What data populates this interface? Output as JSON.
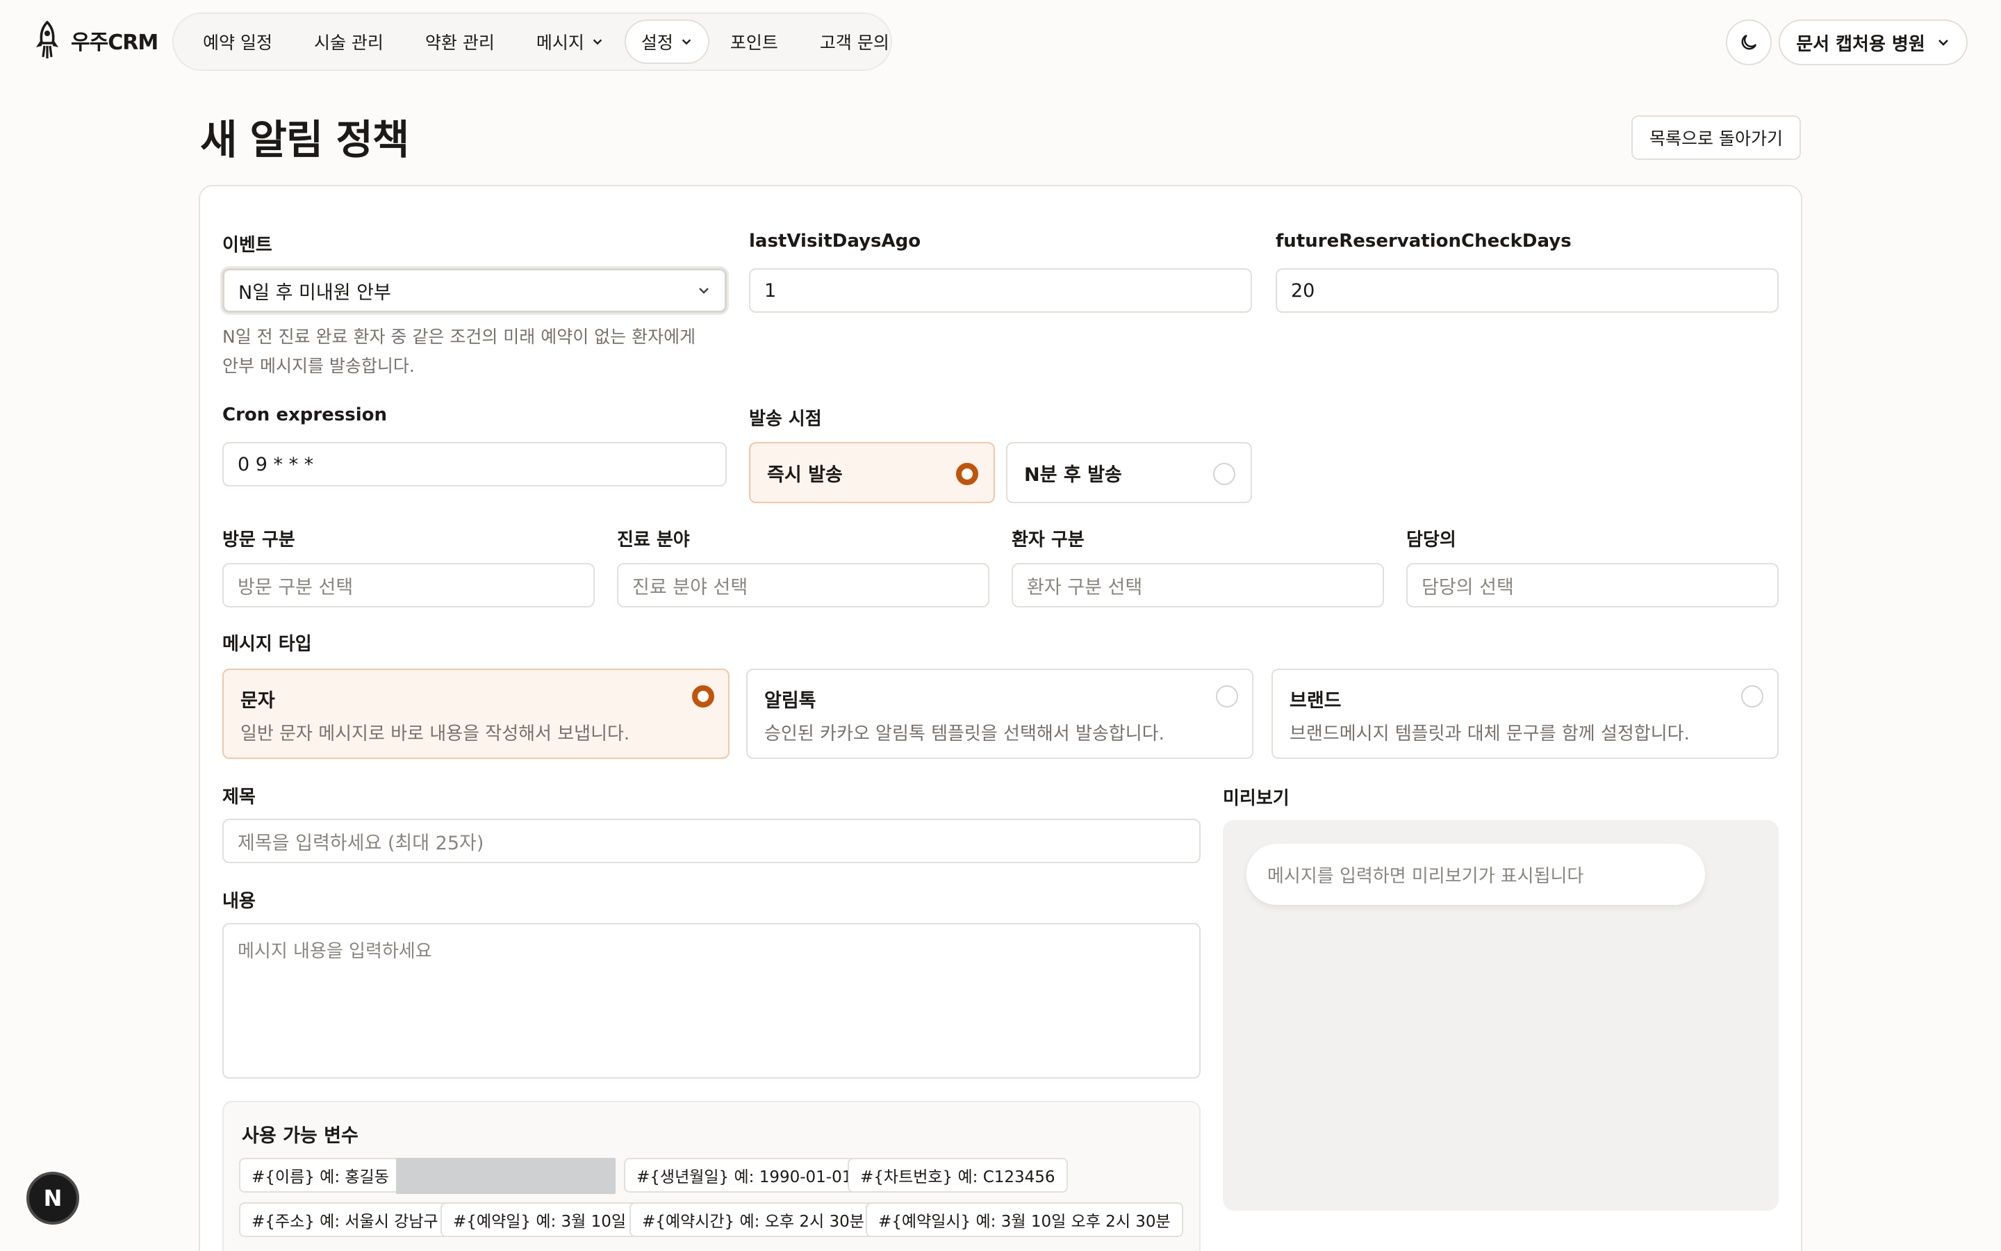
{
  "brand": {
    "name": "우주CRM"
  },
  "nav": {
    "items": [
      {
        "label": "예약 일정",
        "dropdown": false,
        "active": false
      },
      {
        "label": "시술 관리",
        "dropdown": false,
        "active": false
      },
      {
        "label": "약환 관리",
        "dropdown": false,
        "active": false
      },
      {
        "label": "메시지",
        "dropdown": true,
        "active": false
      },
      {
        "label": "설정",
        "dropdown": true,
        "active": true
      },
      {
        "label": "포인트",
        "dropdown": false,
        "active": false
      },
      {
        "label": "고객 문의",
        "dropdown": false,
        "active": false
      }
    ]
  },
  "header": {
    "hospital": "문서 캡처용 병원"
  },
  "page": {
    "title": "새 알림 정책",
    "back_button": "목록으로 돌아가기"
  },
  "form": {
    "event": {
      "label": "이벤트",
      "value": "N일 후 미내원 안부",
      "help_line1": "N일 전 진료 완료 환자 중 같은 조건의 미래 예약이 없는 환자에게",
      "help_line2": "안부 메시지를 발송합니다."
    },
    "last_visit": {
      "label": "lastVisitDaysAgo",
      "value": "1"
    },
    "future_check": {
      "label": "futureReservationCheckDays",
      "value": "20"
    },
    "cron": {
      "label": "Cron expression",
      "value": "0 9 * * *"
    },
    "send_time": {
      "label": "발송 시점",
      "options": [
        {
          "label": "즉시 발송",
          "selected": true
        },
        {
          "label": "N분 후 발송",
          "selected": false
        }
      ]
    },
    "visit_type": {
      "label": "방문 구분",
      "placeholder": "방문 구분 선택"
    },
    "department": {
      "label": "진료 분야",
      "placeholder": "진료 분야 선택"
    },
    "patient_type": {
      "label": "환자 구분",
      "placeholder": "환자 구분 선택"
    },
    "doctor": {
      "label": "담당의",
      "placeholder": "담당의 선택"
    },
    "message_type": {
      "label": "메시지 타입",
      "options": [
        {
          "title": "문자",
          "desc": "일반 문자 메시지로 바로 내용을 작성해서 보냅니다.",
          "selected": true
        },
        {
          "title": "알림톡",
          "desc": "승인된 카카오 알림톡 템플릿을 선택해서 발송합니다.",
          "selected": false
        },
        {
          "title": "브랜드",
          "desc": "브랜드메시지 템플릿과 대체 문구를 함께 설정합니다.",
          "selected": false
        }
      ]
    },
    "subject": {
      "label": "제목",
      "placeholder": "제목을 입력하세요 (최대 25자)"
    },
    "content": {
      "label": "내용",
      "placeholder": "메시지 내용을 입력하세요"
    },
    "preview": {
      "label": "미리보기",
      "empty_text": "메시지를 입력하면 미리보기가 표시됩니다"
    },
    "variables": {
      "title": "사용 가능 변수",
      "chips": [
        "#{이름} 예: 홍길동",
        "#{생년월일} 예: 1990-01-01",
        "#{차트번호} 예: C123456",
        "#{주소} 예: 서울시 강남구",
        "#{예약일} 예: 3월 10일",
        "#{예약시간} 예: 오후 2시 30분",
        "#{예약일시} 예: 3월 10일 오후 2시 30분"
      ]
    }
  },
  "badge": {
    "letter": "N"
  },
  "colors": {
    "accent": "#c2540a",
    "selected_bg": "#fdf4ee",
    "selected_border": "#f0c9a8"
  }
}
